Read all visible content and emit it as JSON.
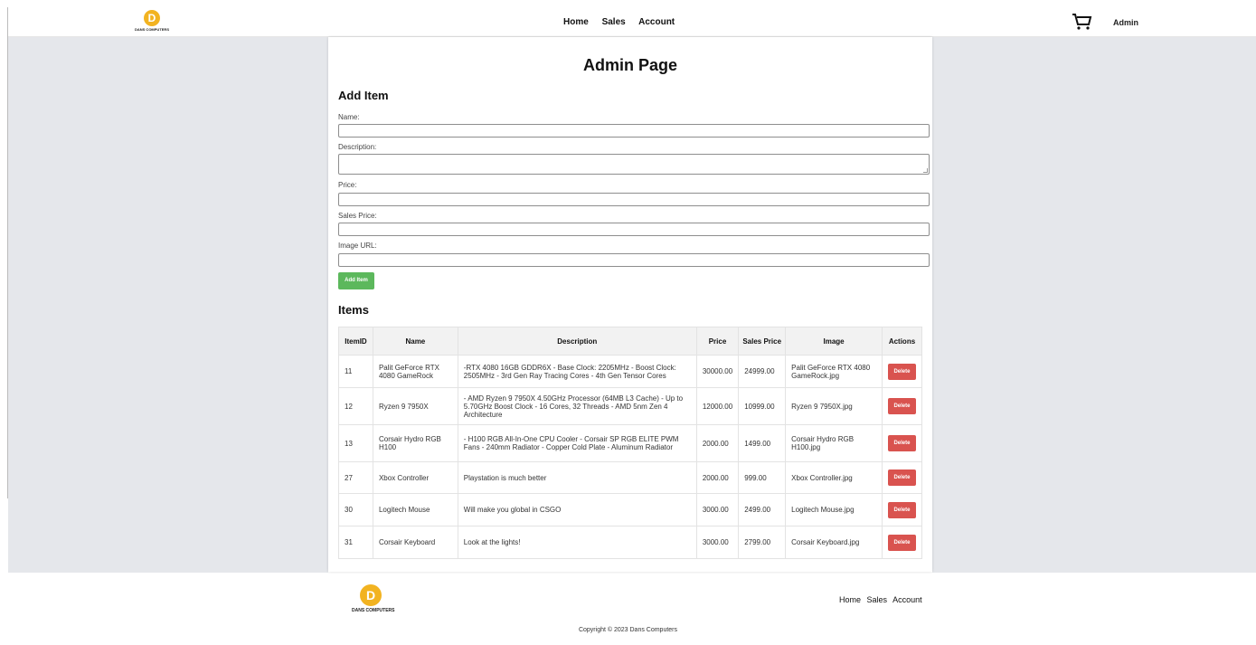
{
  "header": {
    "logo_letter": "D",
    "logo_text": "DANS COMPUTERS",
    "nav": [
      "Home",
      "Sales",
      "Account"
    ],
    "admin_label": "Admin"
  },
  "page": {
    "title": "Admin Page",
    "add_item_heading": "Add Item",
    "items_heading": "Items"
  },
  "form": {
    "name_label": "Name:",
    "name_value": "",
    "description_label": "Description:",
    "description_value": "",
    "price_label": "Price:",
    "price_value": "",
    "sales_price_label": "Sales Price:",
    "sales_price_value": "",
    "image_url_label": "Image URL:",
    "image_url_value": "",
    "submit_label": "Add Item"
  },
  "table": {
    "headers": [
      "ItemID",
      "Name",
      "Description",
      "Price",
      "Sales Price",
      "Image",
      "Actions"
    ],
    "rows": [
      {
        "id": "11",
        "name": "Palit GeForce RTX 4080 GameRock",
        "description": "-RTX 4080 16GB GDDR6X - Base Clock: 2205MHz - Boost Clock: 2505MHz - 3rd Gen Ray Tracing Cores - 4th Gen Tensor Cores",
        "price": "30000.00",
        "sales_price": "24999.00",
        "image": "Palit GeForce RTX 4080 GameRock.jpg",
        "action": "Delete"
      },
      {
        "id": "12",
        "name": "Ryzen 9 7950X",
        "description": "- AMD Ryzen 9 7950X 4.50GHz Processor (64MB L3 Cache) - Up to 5.70GHz Boost Clock - 16 Cores, 32 Threads - AMD 5nm Zen 4 Architecture",
        "price": "12000.00",
        "sales_price": "10999.00",
        "image": "Ryzen 9 7950X.jpg",
        "action": "Delete"
      },
      {
        "id": "13",
        "name": "Corsair Hydro RGB H100",
        "description": "- H100 RGB All-In-One CPU Cooler - Corsair SP RGB ELITE PWM Fans - 240mm Radiator - Copper Cold Plate - Aluminum Radiator",
        "price": "2000.00",
        "sales_price": "1499.00",
        "image": "Corsair Hydro RGB H100.jpg",
        "action": "Delete"
      },
      {
        "id": "27",
        "name": "Xbox Controller",
        "description": "Playstation is much better",
        "price": "2000.00",
        "sales_price": "999.00",
        "image": "Xbox Controller.jpg",
        "action": "Delete"
      },
      {
        "id": "30",
        "name": "Logitech Mouse",
        "description": "Will make you global in CSGO",
        "price": "3000.00",
        "sales_price": "2499.00",
        "image": "Logitech Mouse.jpg",
        "action": "Delete"
      },
      {
        "id": "31",
        "name": "Corsair Keyboard",
        "description": "Look at the lights!",
        "price": "3000.00",
        "sales_price": "2799.00",
        "image": "Corsair Keyboard.jpg",
        "action": "Delete"
      }
    ]
  },
  "footer": {
    "logo_letter": "D",
    "logo_text": "DANS COMPUTERS",
    "nav": [
      "Home",
      "Sales",
      "Account"
    ],
    "copyright": "Copyright © 2023 Dans Computers"
  },
  "icons": {
    "cart": "shopping-cart-icon"
  },
  "colors": {
    "add_button": "#5cb85c",
    "delete_button": "#d9534f",
    "logo": "#f2b321",
    "background_gray": "#e5e7eb"
  }
}
